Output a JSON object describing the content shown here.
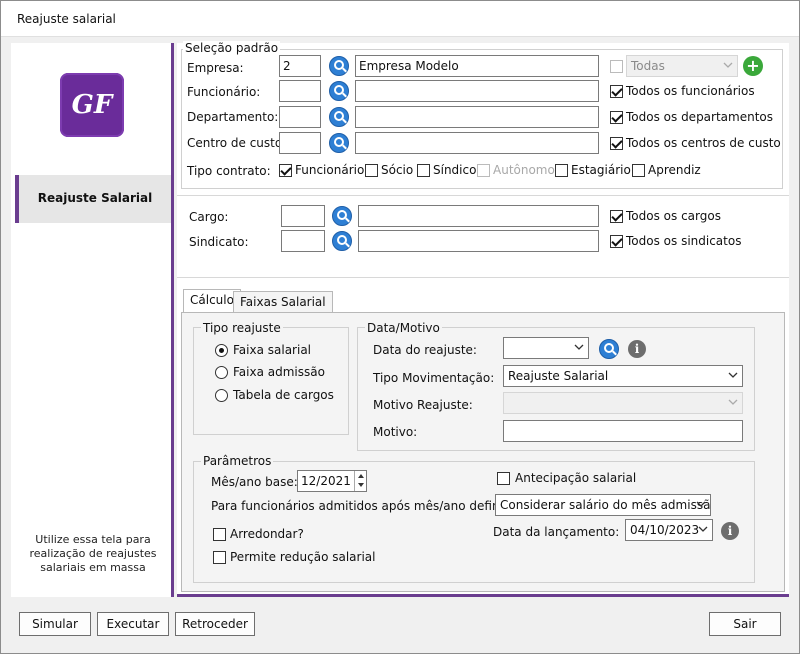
{
  "window": {
    "title": "Reajuste salarial"
  },
  "sidebar": {
    "logo_text": "GF",
    "item_label": "Reajuste Salarial",
    "note": "Utilize essa tela para realização de reajustes salariais em massa"
  },
  "selecao": {
    "title": "Seleção padrão",
    "empresa_label": "Empresa:",
    "empresa_code": "2",
    "empresa_name": "Empresa Modelo",
    "todas_label": "Todas",
    "funcionario_label": "Funcionário:",
    "funcionario_all": "Todos os funcionários",
    "departamento_label": "Departamento:",
    "departamento_all": "Todos os departamentos",
    "centro_label": "Centro de custo:",
    "centro_all": "Todos os centros de custo",
    "tipo_contrato_label": "Tipo contrato:",
    "contratos": [
      "Funcionário",
      "Sócio",
      "Síndico",
      "Autônomo",
      "Estagiário",
      "Aprendiz"
    ]
  },
  "cargo_group": {
    "cargo_label": "Cargo:",
    "cargo_all": "Todos os cargos",
    "sindicato_label": "Sindicato:",
    "sindicato_all": "Todos os sindicatos"
  },
  "tabs": [
    "Cálculo",
    "Faixas Salarial"
  ],
  "calculo": {
    "tipo_reajuste_title": "Tipo reajuste",
    "tipo_options": [
      "Faixa salarial",
      "Faixa admissão",
      "Tabela de cargos"
    ],
    "data_motivo_title": "Data/Motivo",
    "data_reajuste_label": "Data do reajuste:",
    "tipo_mov_label": "Tipo Movimentação:",
    "tipo_mov_value": "Reajuste Salarial",
    "motivo_reajuste_label": "Motivo Reajuste:",
    "motivo_label": "Motivo:",
    "parametros_title": "Parâmetros",
    "mes_ano_label": "Mês/ano base:",
    "mes_ano_value": "12/2021",
    "antecipacao_label": "Antecipação salarial",
    "admitidos_label": "Para funcionários admitidos após mês/ano definido:",
    "admitidos_value": "Considerar salário do mês admissão",
    "arredondar_label": "Arredondar?",
    "data_lanc_label": "Data da lançamento:",
    "data_lanc_value": "04/10/2023",
    "reducao_label": "Permite redução salarial"
  },
  "buttons": {
    "simular": "Simular",
    "executar": "Executar",
    "retroceder": "Retroceder",
    "sair": "Sair"
  },
  "colors": {
    "accent": "#6a3d8f",
    "logo": "#6a2c9a",
    "search": "#2e7fd4",
    "add": "#3aa83a"
  }
}
